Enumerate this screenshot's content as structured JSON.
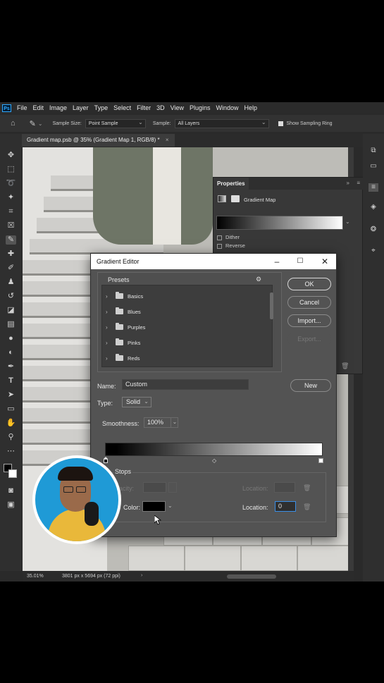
{
  "menubar": {
    "logo": "Ps",
    "items": [
      "File",
      "Edit",
      "Image",
      "Layer",
      "Type",
      "Select",
      "Filter",
      "3D",
      "View",
      "Plugins",
      "Window",
      "Help"
    ]
  },
  "options": {
    "sample_size_label": "Sample Size:",
    "sample_size_value": "Point Sample",
    "sample_label": "Sample:",
    "sample_value": "All Layers",
    "show_ring_label": "Show Sampling Ring"
  },
  "document": {
    "tab_title": "Gradient map.psb @ 35% (Gradient Map 1, RGB/8) *",
    "zoom": "35.01%",
    "dimensions": "3801 px x 5694 px (72 ppi)"
  },
  "properties": {
    "tab": "Properties",
    "layer_type": "Gradient Map",
    "dither_label": "Dither",
    "reverse_label": "Reverse"
  },
  "gradient_editor": {
    "title": "Gradient Editor",
    "presets_label": "Presets",
    "presets": [
      "Basics",
      "Blues",
      "Purples",
      "Pinks",
      "Reds"
    ],
    "buttons": {
      "ok": "OK",
      "cancel": "Cancel",
      "import": "Import...",
      "export": "Export...",
      "new": "New"
    },
    "name_label": "Name:",
    "name_value": "Custom",
    "type_label": "Type:",
    "type_value": "Solid",
    "smoothness_label": "Smoothness:",
    "smoothness_value": "100%",
    "stops_label": "Stops",
    "opacity_label": "Opacity:",
    "color_label": "Color:",
    "location_label": "Location:",
    "location_value": "0",
    "stop_color": "#000000"
  },
  "colors": {
    "accent_focus": "#3a8ee6",
    "dialog_bg": "#535353"
  }
}
